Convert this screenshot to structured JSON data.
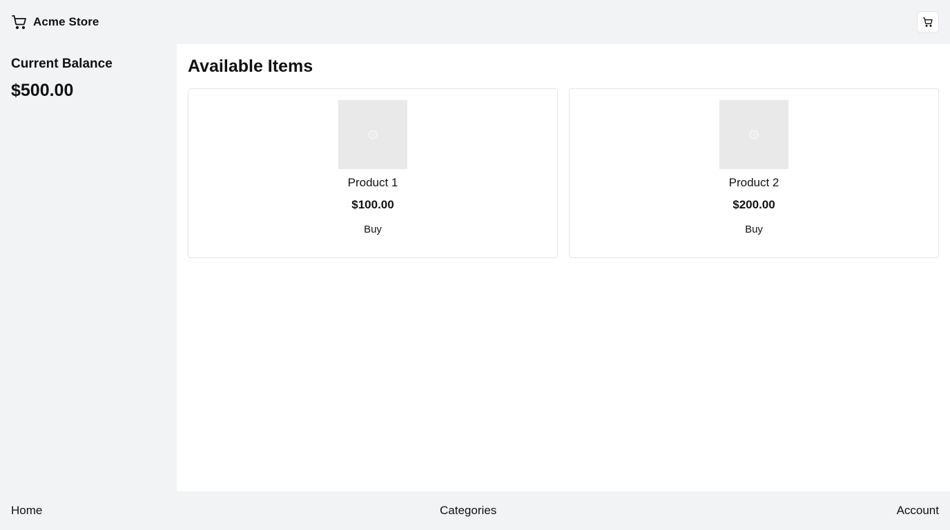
{
  "header": {
    "brand_icon": "shopping-cart-icon",
    "brand_name": "Acme Store",
    "cart_button_icon": "shopping-cart-icon"
  },
  "sidebar": {
    "balance_label": "Current Balance",
    "balance_value": "$500.00"
  },
  "main": {
    "title": "Available Items",
    "products": [
      {
        "image_icon": "image-placeholder-icon",
        "name": "Product 1",
        "price": "$100.00",
        "buy_label": "Buy"
      },
      {
        "image_icon": "image-placeholder-icon",
        "name": "Product 2",
        "price": "$200.00",
        "buy_label": "Buy"
      }
    ]
  },
  "footer": {
    "links": [
      {
        "label": "Home"
      },
      {
        "label": "Categories"
      },
      {
        "label": "Account"
      }
    ]
  },
  "colors": {
    "page_background": "#f2f3f5",
    "content_background": "#ffffff",
    "card_border": "#e3e5e8",
    "image_placeholder": "#e9e9e9",
    "text": "#111111"
  }
}
